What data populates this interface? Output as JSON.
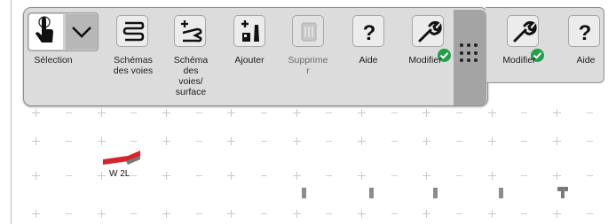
{
  "toolbar": {
    "selection_label": "Sélection",
    "tools": [
      {
        "id": "schemas-voies",
        "label": "Schémas des voies",
        "icon": "track-diagrams-icon"
      },
      {
        "id": "schema-voies-surface",
        "label": "Schéma des voies/ surface",
        "icon": "track-surface-icon"
      },
      {
        "id": "ajouter",
        "label": "Ajouter",
        "icon": "add-item-icon"
      },
      {
        "id": "supprimer",
        "label": "Supprimer",
        "icon": "trash-icon",
        "disabled": true
      },
      {
        "id": "aide",
        "label": "Aide",
        "icon": "question-icon"
      },
      {
        "id": "modifier",
        "label": "Modifier",
        "icon": "wrench-icon"
      }
    ],
    "label_parts": {
      "schemas_l1": "Schémas",
      "schemas_l2": "des voies",
      "schema_l1": "Schéma",
      "schema_l2": "des",
      "schema_l3": "voies/",
      "schema_l4": "surface",
      "ajouter": "Ajouter",
      "supprimer_l1": "Supprime",
      "supprimer_l2": "r",
      "aide": "Aide",
      "modifier": "Modifier"
    }
  },
  "secondary_toolbar": {
    "modifier": "Modifier",
    "aide": "Aide"
  },
  "canvas": {
    "track_label": "W 2L"
  },
  "colors": {
    "panel": "#dcdcdc",
    "grip": "#a4a4a4",
    "check_green": "#22a04a",
    "track_red": "#d6252a"
  }
}
